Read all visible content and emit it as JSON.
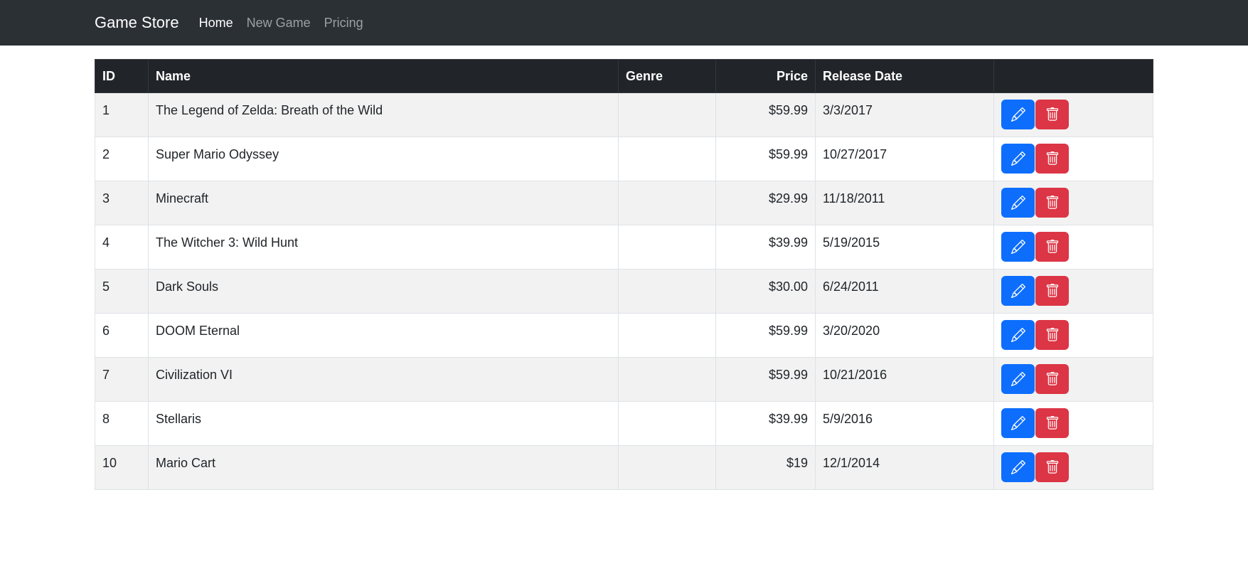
{
  "navbar": {
    "brand": "Game Store",
    "links": [
      {
        "label": "Home",
        "active": true
      },
      {
        "label": "New Game",
        "active": false
      },
      {
        "label": "Pricing",
        "active": false
      }
    ]
  },
  "table": {
    "headers": [
      "ID",
      "Name",
      "Genre",
      "Price",
      "Release Date",
      ""
    ],
    "rows": [
      {
        "id": "1",
        "name": "The Legend of Zelda: Breath of the Wild",
        "genre": "",
        "price": "$59.99",
        "release": "3/3/2017"
      },
      {
        "id": "2",
        "name": "Super Mario Odyssey",
        "genre": "",
        "price": "$59.99",
        "release": "10/27/2017"
      },
      {
        "id": "3",
        "name": "Minecraft",
        "genre": "",
        "price": "$29.99",
        "release": "11/18/2011"
      },
      {
        "id": "4",
        "name": "The Witcher 3: Wild Hunt",
        "genre": "",
        "price": "$39.99",
        "release": "5/19/2015"
      },
      {
        "id": "5",
        "name": "Dark Souls",
        "genre": "",
        "price": "$30.00",
        "release": "6/24/2011"
      },
      {
        "id": "6",
        "name": "DOOM Eternal",
        "genre": "",
        "price": "$59.99",
        "release": "3/20/2020"
      },
      {
        "id": "7",
        "name": "Civilization VI",
        "genre": "",
        "price": "$59.99",
        "release": "10/21/2016"
      },
      {
        "id": "8",
        "name": "Stellaris",
        "genre": "",
        "price": "$39.99",
        "release": "5/9/2016"
      },
      {
        "id": "10",
        "name": "Mario Cart",
        "genre": "",
        "price": "$19",
        "release": "12/1/2014"
      }
    ]
  },
  "icons": {
    "edit": "pencil-icon",
    "delete": "trash-icon"
  },
  "colors": {
    "navbar": "#2b3035",
    "header": "#212529",
    "edit": "#0d6efd",
    "delete": "#dc3545",
    "stripe": "#f2f2f2"
  }
}
